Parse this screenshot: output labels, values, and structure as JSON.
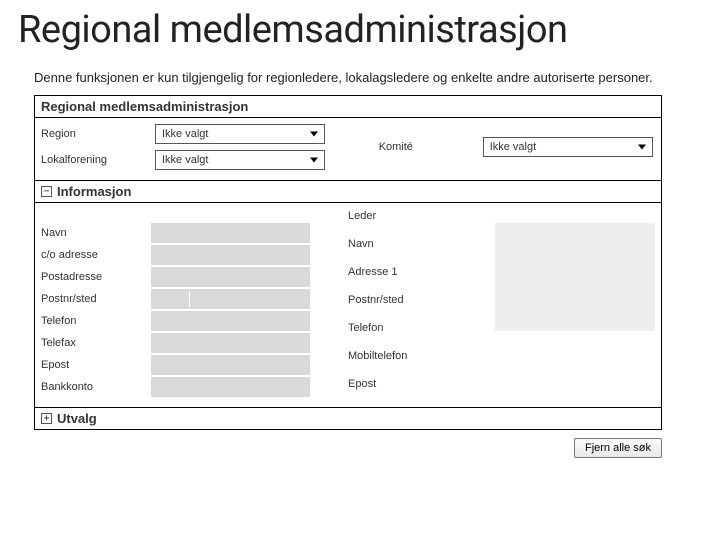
{
  "page_title": "Regional medlemsadministrasjon",
  "intro": "Denne funksjonen er kun tilgjengelig for regionledere, lokalagsledere og enkelte andre autoriserte personer.",
  "panel_header": "Regional medlemsadministrasjon",
  "filters": {
    "region_label": "Region",
    "region_value": "Ikke valgt",
    "lokalforening_label": "Lokalforening",
    "lokalforening_value": "Ikke valgt",
    "komite_label": "Komité",
    "komite_value": "Ikke valgt"
  },
  "informasjon": {
    "header": "Informasjon",
    "toggle_glyph": "−",
    "left_labels": {
      "navn": "Navn",
      "co_adresse": "c/o adresse",
      "postadresse": "Postadresse",
      "postnr_sted": "Postnr/sted",
      "telefon": "Telefon",
      "telefax": "Telefax",
      "epost": "Epost",
      "bankkonto": "Bankkonto"
    },
    "leder": {
      "title": "Leder",
      "navn": "Navn",
      "adresse1": "Adresse 1",
      "postnr_sted": "Postnr/sted",
      "telefon": "Telefon",
      "mobiltelefon": "Mobiltelefon",
      "epost": "Epost"
    }
  },
  "utvalg": {
    "header": "Utvalg",
    "toggle_glyph": "+"
  },
  "footer": {
    "clear_button": "Fjern alle søk"
  }
}
